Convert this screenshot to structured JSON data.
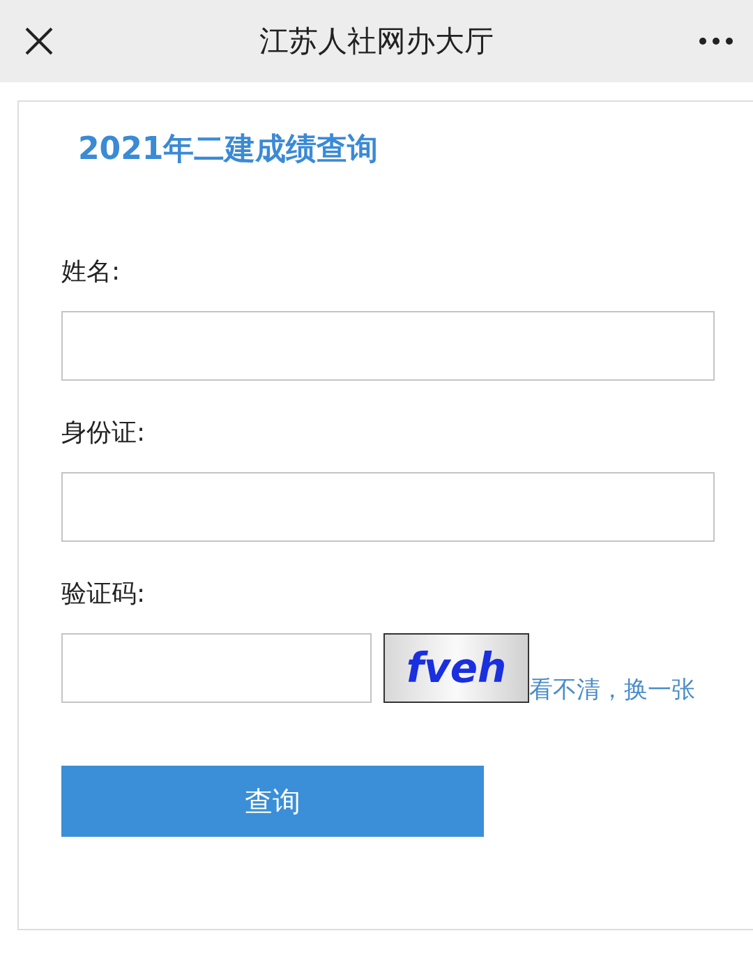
{
  "window": {
    "title": "江苏人社网办大厅"
  },
  "page": {
    "heading": "2021年二建成绩查询"
  },
  "fields": [
    {
      "label": "姓名:"
    },
    {
      "label": "身份证:"
    }
  ],
  "captcha": {
    "label": "验证码:",
    "captcha_text": "fveh",
    "refresh_link": "看不清，换一张"
  },
  "submit": {
    "label": "查询"
  }
}
